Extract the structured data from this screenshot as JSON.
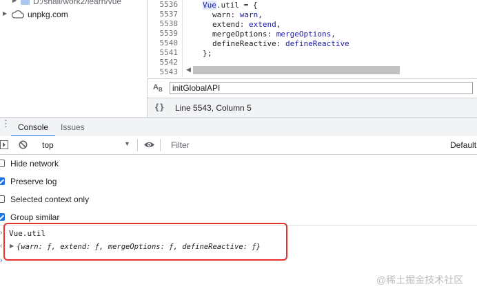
{
  "file_tree": {
    "items": [
      {
        "label": "D:/shall/work2/learn/vue",
        "icon": "folder-icon"
      },
      {
        "label": "unpkg.com",
        "icon": "cloud-icon"
      }
    ]
  },
  "editor": {
    "lines": [
      {
        "num": "5536",
        "code_name": "Vue",
        "code_rest": ".util = {"
      },
      {
        "num": "5537",
        "key": "warn",
        "val": "warn"
      },
      {
        "num": "5538",
        "key": "extend",
        "val": "extend"
      },
      {
        "num": "5539",
        "key": "mergeOptions",
        "val": "mergeOptions"
      },
      {
        "num": "5540",
        "key": "defineReactive",
        "val": "defineReactive"
      },
      {
        "num": "5541",
        "text": "};"
      },
      {
        "num": "5542",
        "text": ""
      },
      {
        "num": "5543",
        "text": ""
      }
    ],
    "search_value": "initGlobalAPI",
    "status_text": "Line 5543, Column 5",
    "format_icon_text": "{}"
  },
  "drawer": {
    "tabs": [
      "Console",
      "Issues"
    ],
    "context": "top",
    "filter_placeholder": "Filter",
    "levels": "Default"
  },
  "settings": [
    {
      "label": "Hide network",
      "checked": false
    },
    {
      "label": "Preserve log",
      "checked": true
    },
    {
      "label": "Selected context only",
      "checked": false
    },
    {
      "label": "Group similar",
      "checked": true
    }
  ],
  "console": {
    "input": "Vue.util",
    "output": "{warn: ƒ, extend: ƒ, mergeOptions: ƒ, defineReactive: ƒ}"
  },
  "watermark": "@稀土掘金技术社区",
  "colors": {
    "accent": "#1a73e8",
    "annotation": "#e8302e"
  }
}
